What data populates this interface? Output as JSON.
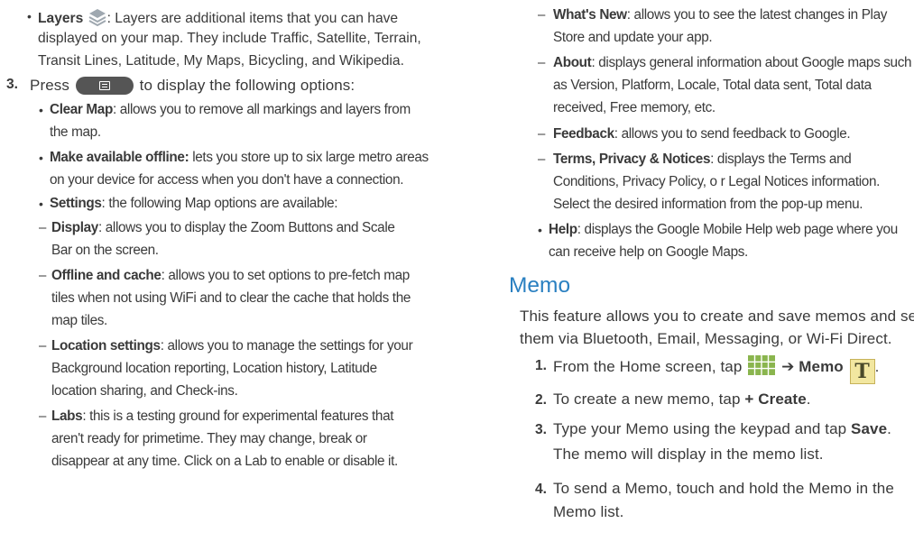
{
  "left": {
    "layers_item": {
      "label": "Layers",
      "line1": ": Layers are additional items that you can have",
      "line2": "displayed on your map. They include Traffic, Satellite, Terrain,",
      "line3": "Transit Lines, Latitude, My Maps, Bicycling, and Wikipedia."
    },
    "step3": {
      "num": "3.",
      "pre": "Press",
      "post": "to display the following options:"
    },
    "clear_map": {
      "label": "Clear Map",
      "line1": ": allows you to remove all markings and layers from",
      "line2": "the map."
    },
    "offline": {
      "label": "Make available offline:",
      "line1": " lets you store up to six large metro areas",
      "line2": "on your device for access when you don't have a connection."
    },
    "settings": {
      "label": "Settings",
      "line1": ": the following Map options are available:"
    },
    "display": {
      "label": "Display",
      "line1": ": allows you to display the Zoom Buttons and Scale",
      "line2": "Bar on the screen."
    },
    "offline_cache": {
      "label": "Offline and cache",
      "line1": ": allows you to set options to pre-fetch map",
      "line2": "tiles when not using WiFi and to clear the cache that holds the",
      "line3": "map tiles."
    },
    "location": {
      "label": "Location settings",
      "line1": ": allows you to manage the settings for your",
      "line2": "Background location reporting, Location history, Latitude",
      "line3": "location sharing, and Check-ins."
    },
    "labs": {
      "label": "Labs",
      "line1": ": this is a testing ground for experimental features that",
      "line2": "aren't ready for primetime. They may change, break or",
      "line3": "disappear at any time. Click on a Lab to enable or disable it."
    }
  },
  "right": {
    "whats_new": {
      "label": "What's New",
      "line1": ": allows you to see the latest changes in Play",
      "line2": "Store and update your app."
    },
    "about": {
      "label": "About",
      "line1": ": displays general information about Google maps such",
      "line2": "as Version, Platform, Locale, Total data sent, Total data",
      "line3": "received, Free memory, etc."
    },
    "feedback": {
      "label": "Feedback",
      "line1": ": allows you to send feedback to Google."
    },
    "terms": {
      "label": "Terms, Privacy & Notices",
      "line1": ": displays the Terms and",
      "line2": "Conditions, Privacy Policy, o r Legal Notices information.",
      "line3": "Select the desired information from the pop-up menu."
    },
    "help": {
      "label": "Help",
      "line1": ": displays the Google Mobile Help web page where you",
      "line2": "can receive help on Google Maps."
    },
    "memo_heading": "Memo",
    "memo_intro1": "This feature allows you to create and save memos and send",
    "memo_intro2": "them via Bluetooth, Email, Messaging, or Wi-Fi Direct.",
    "step1": {
      "num": "1.",
      "pre": "From the Home screen, tap",
      "arrow": "➔",
      "label": "Memo",
      "end": "."
    },
    "step2": {
      "num": "2.",
      "pre": "To create a new memo, tap",
      "label": "+ Create",
      "end": "."
    },
    "step3": {
      "num": "3.",
      "pre": "Type your Memo using the keypad and tap",
      "label": "Save",
      "end": ".",
      "line2": "The memo will display in the memo list."
    },
    "step4": {
      "num": "4.",
      "line1": "To send a Memo, touch and hold the Memo in the",
      "line2": "Memo list."
    }
  },
  "icons": {
    "layers": "layers-icon",
    "menu_key": "menu-key-icon",
    "apps": "apps-icon",
    "memo": "memo-app-icon"
  }
}
